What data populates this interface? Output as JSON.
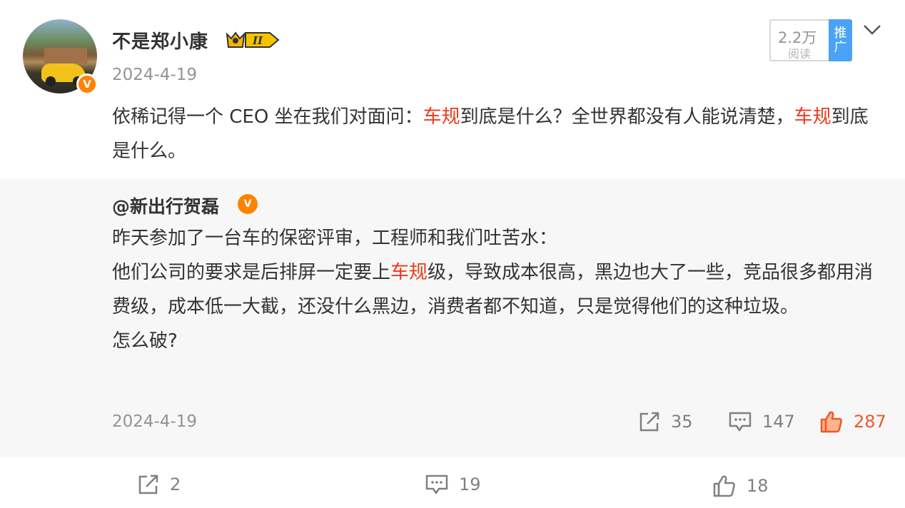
{
  "post": {
    "username": "不是郑小康",
    "level_badge": "II",
    "date": "2024-4-19",
    "reads_count": "2.2万",
    "reads_label": "阅读",
    "promo_label_1": "推",
    "promo_label_2": "广",
    "text_part1": "依稀记得一个 CEO 坐在我们对面问：",
    "text_hl1": "车规",
    "text_part2": "到底是什么？全世界都没有人能说清楚，",
    "text_hl2": "车规",
    "text_part3": "到底是什么。"
  },
  "repost": {
    "username": "@新出行贺磊",
    "line1": "昨天参加了一台车的保密评审，工程师和我们吐苦水：",
    "line2_part1": "他们公司的要求是后排屏一定要上",
    "line2_hl": "车规",
    "line2_part2": "级，导致成本很高，黑边也大了一些，竞品很多都用消费级，成本低一大截，还没什么黑边，消费者都不知道，只是觉得他们的这种垃圾。",
    "line3": "怎么破?",
    "date": "2024-4-19",
    "shares": "35",
    "comments": "147",
    "likes": "287"
  },
  "footer": {
    "shares": "2",
    "comments": "19",
    "likes": "18"
  },
  "colors": {
    "highlight": "#eb3a1a",
    "verified": "#ff8200",
    "promo": "#4aa3f6",
    "like_active": "#eb5a2a"
  }
}
